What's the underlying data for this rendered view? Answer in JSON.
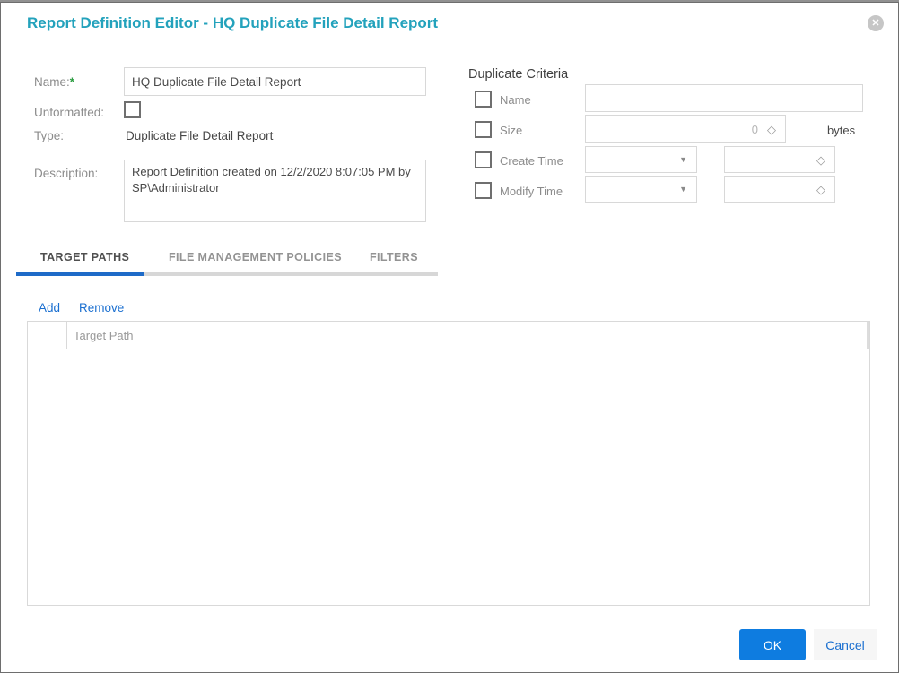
{
  "dialog": {
    "title": "Report Definition Editor - HQ Duplicate File Detail Report",
    "close_icon": "circle-x-icon",
    "close_glyph": "✕"
  },
  "form": {
    "name_label": "Name:",
    "required_marker": "*",
    "name_value": "HQ Duplicate File Detail Report",
    "unformatted_label": "Unformatted:",
    "unformatted_checked": false,
    "type_label": "Type:",
    "type_value": "Duplicate File Detail Report",
    "description_label": "Description:",
    "description_value": "Report Definition created on 12/2/2020 8:07:05 PM by SP\\Administrator"
  },
  "duplicate_criteria": {
    "heading": "Duplicate Criteria",
    "rows": [
      {
        "label": "Name",
        "checked": false,
        "control": "text-input",
        "value": ""
      },
      {
        "label": "Size",
        "checked": false,
        "control": "number-spinner",
        "value": "0",
        "unit": "bytes"
      },
      {
        "label": "Create Time",
        "checked": false,
        "control": "dropdown-and-spinner",
        "dropdown_value": "",
        "spinner_value": ""
      },
      {
        "label": "Modify Time",
        "checked": false,
        "control": "dropdown-and-spinner",
        "dropdown_value": "",
        "spinner_value": ""
      }
    ],
    "spinner_glyph": "◇",
    "dropdown_glyph": "▼"
  },
  "tabs": [
    {
      "label": "TARGET PATHS",
      "active": true
    },
    {
      "label": "FILE MANAGEMENT POLICIES",
      "active": false
    },
    {
      "label": "FILTERS",
      "active": false
    }
  ],
  "target_paths_toolbar": {
    "add_label": "Add",
    "remove_label": "Remove"
  },
  "target_paths_table": {
    "columns": [
      "",
      "Target Path"
    ],
    "rows": []
  },
  "footer": {
    "ok_label": "OK",
    "cancel_label": "Cancel"
  },
  "colors": {
    "title_teal": "#23a2bc",
    "link_blue": "#1a6fd0",
    "ok_button_blue": "#0e7ce0",
    "tab_underline_blue": "#1e6bc8",
    "required_green": "#2f9e44",
    "label_gray": "#8c8c8c",
    "border_gray": "#d8d8d8",
    "dialog_border": "#6e6e6e"
  }
}
